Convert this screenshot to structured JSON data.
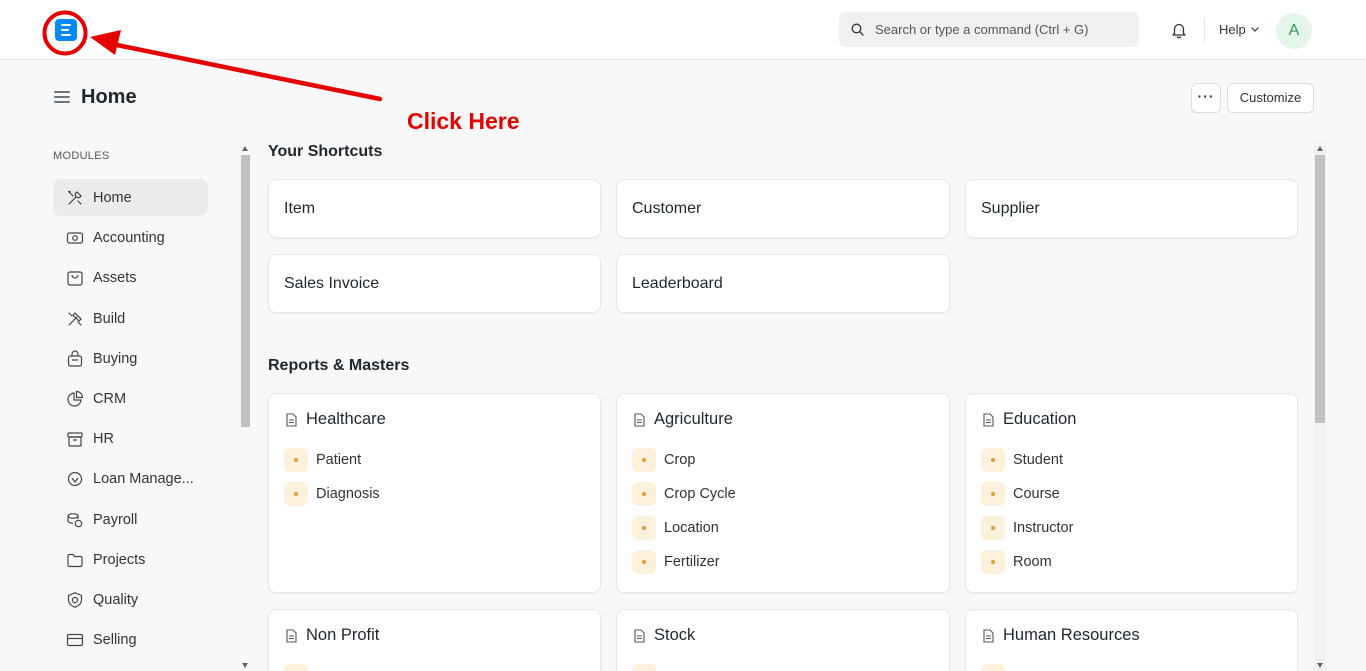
{
  "navbar": {
    "search_placeholder": "Search or type a command (Ctrl + G)",
    "help_label": "Help",
    "avatar_initial": "A",
    "logo_icon": "erpnext-logo-icon"
  },
  "page": {
    "title": "Home",
    "more_label": "···",
    "customize_label": "Customize"
  },
  "sidebar": {
    "section_label": "MODULES",
    "items": [
      {
        "label": "Home",
        "icon": "home-tools-icon",
        "active": true
      },
      {
        "label": "Accounting",
        "icon": "money-icon"
      },
      {
        "label": "Assets",
        "icon": "briefcase-icon"
      },
      {
        "label": "Build",
        "icon": "tools-icon"
      },
      {
        "label": "Buying",
        "icon": "purchase-bag-icon"
      },
      {
        "label": "CRM",
        "icon": "pie-chart-icon"
      },
      {
        "label": "HR",
        "icon": "hr-box-icon"
      },
      {
        "label": "Loan Manage...",
        "icon": "loan-icon"
      },
      {
        "label": "Payroll",
        "icon": "coins-icon"
      },
      {
        "label": "Projects",
        "icon": "folder-icon"
      },
      {
        "label": "Quality",
        "icon": "shield-check-icon"
      },
      {
        "label": "Selling",
        "icon": "card-icon"
      }
    ]
  },
  "shortcuts": {
    "title": "Your Shortcuts",
    "items": [
      "Item",
      "Customer",
      "Supplier",
      "Sales Invoice",
      "Leaderboard"
    ]
  },
  "reports": {
    "title": "Reports & Masters",
    "cards": [
      {
        "title": "Healthcare",
        "links": [
          "Patient",
          "Diagnosis"
        ]
      },
      {
        "title": "Agriculture",
        "links": [
          "Crop",
          "Crop Cycle",
          "Location",
          "Fertilizer"
        ]
      },
      {
        "title": "Education",
        "links": [
          "Student",
          "Course",
          "Instructor",
          "Room"
        ]
      },
      {
        "title": "Non Profit",
        "links": []
      },
      {
        "title": "Stock",
        "links": []
      },
      {
        "title": "Human Resources",
        "links": []
      }
    ]
  },
  "annotation": {
    "text": "Click Here",
    "color": "#e50000"
  },
  "colors": {
    "brand": "#0089ff",
    "bullet_bg": "#fdf1dc",
    "bullet_dot": "#e79a3a",
    "annotation": "#e50000"
  }
}
